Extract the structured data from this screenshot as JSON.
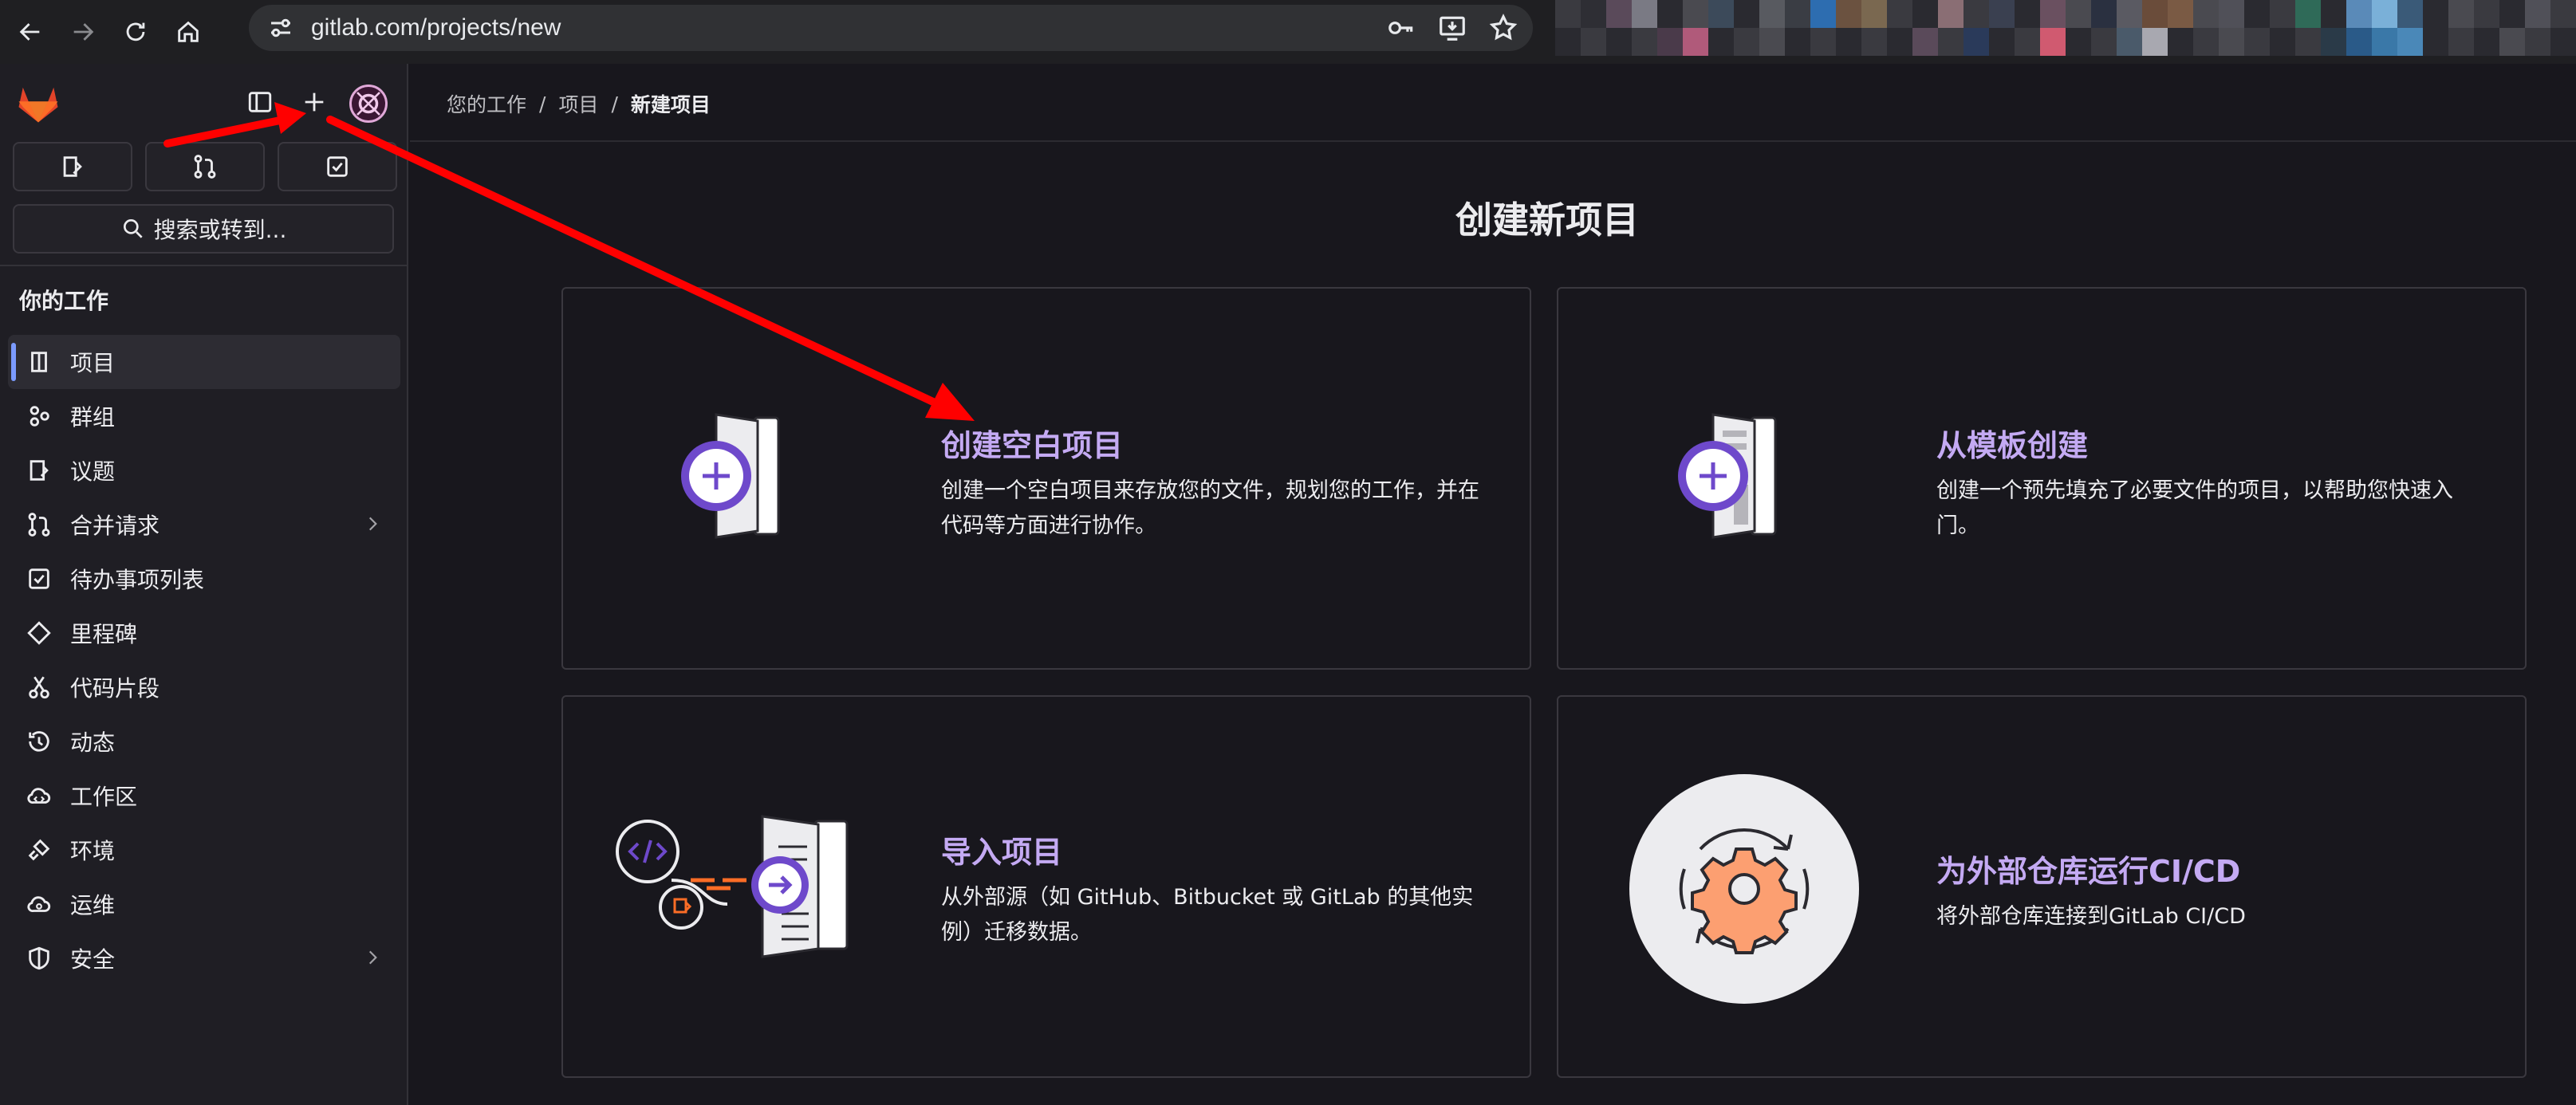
{
  "browser": {
    "url": "gitlab.com/projects/new"
  },
  "sidebar": {
    "search_label": "搜索或转到...",
    "section_title": "你的工作",
    "items": [
      {
        "label": "项目",
        "icon": "project-icon",
        "active": true
      },
      {
        "label": "群组",
        "icon": "group-icon"
      },
      {
        "label": "议题",
        "icon": "issues-icon"
      },
      {
        "label": "合并请求",
        "icon": "merge-request-icon",
        "has_children": true
      },
      {
        "label": "待办事项列表",
        "icon": "todo-icon"
      },
      {
        "label": "里程碑",
        "icon": "milestone-icon"
      },
      {
        "label": "代码片段",
        "icon": "snippet-icon"
      },
      {
        "label": "动态",
        "icon": "activity-icon"
      },
      {
        "label": "工作区",
        "icon": "workspace-icon"
      },
      {
        "label": "环境",
        "icon": "environment-icon"
      },
      {
        "label": "运维",
        "icon": "operations-icon"
      },
      {
        "label": "安全",
        "icon": "security-icon",
        "has_children": true
      }
    ]
  },
  "breadcrumb": {
    "items": [
      "您的工作",
      "项目"
    ],
    "current": "新建项目"
  },
  "page": {
    "title": "创建新项目"
  },
  "cards": [
    {
      "title": "创建空白项目",
      "desc": "创建一个空白项目来存放您的文件，规划您的工作，并在代码等方面进行协作。",
      "icon": "blank-project-illustration"
    },
    {
      "title": "从模板创建",
      "desc": "创建一个预先填充了必要文件的项目，以帮助您快速入门。",
      "icon": "template-illustration"
    },
    {
      "title": "导入项目",
      "desc": "从外部源（如 GitHub、Bitbucket 或 GitLab 的其他实例）迁移数据。",
      "icon": "import-illustration"
    },
    {
      "title": "为外部仓库运行CI/CD",
      "desc": "将外部仓库连接到GitLab CI/CD",
      "icon": "cicd-illustration"
    }
  ],
  "colors": {
    "accent_purple": "#c4aaf3",
    "annotation_arrow": "#ff0000",
    "gitlab_orange": "#fc6d26"
  }
}
